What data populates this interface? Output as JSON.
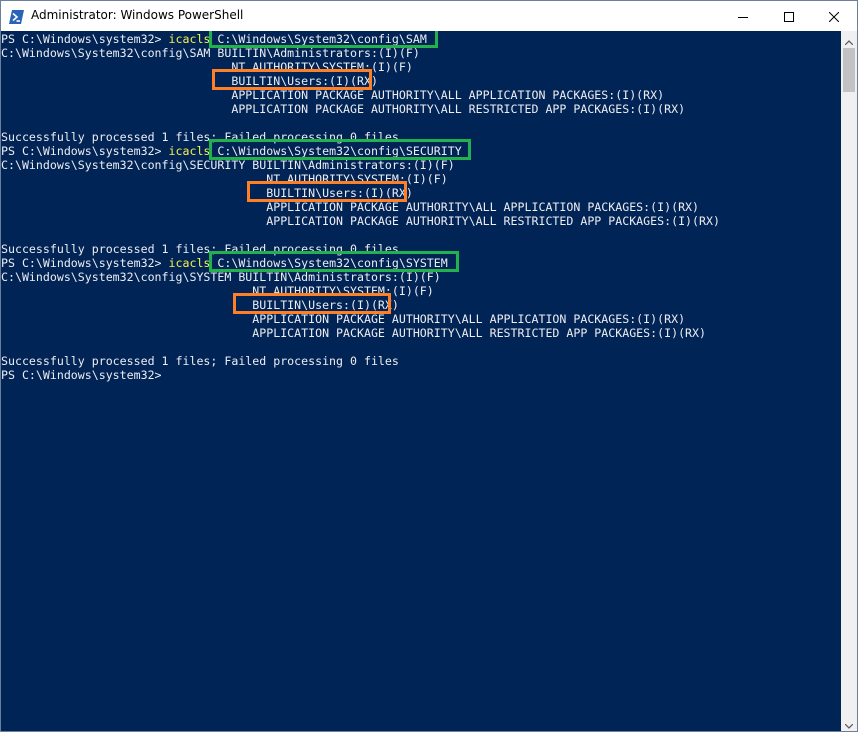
{
  "window": {
    "title": "Administrator: Windows PowerShell",
    "icon": "powershell-icon",
    "controls": {
      "minimize": "minimize-icon",
      "maximize": "maximize-icon",
      "close": "close-icon"
    },
    "colors": {
      "console_background": "#012456",
      "console_text": "#eeedf0",
      "command_keyword": "#f9f14f",
      "highlight_green": "#22b14c",
      "highlight_orange": "#ff7f27"
    }
  },
  "console": {
    "sam": {
      "prompt": "PS C:\\Windows\\system32> ",
      "command": "icacls",
      "path": " C:\\Windows\\System32\\config\\SAM",
      "acl_1": "C:\\Windows\\System32\\config\\SAM BUILTIN\\Administrators:(I)(F)",
      "acl_2": "                                 NT AUTHORITY\\SYSTEM:(I)(F)",
      "acl_3": "                                 BUILTIN\\Users:(I)(RX)",
      "acl_4": "                                 APPLICATION PACKAGE AUTHORITY\\ALL APPLICATION PACKAGES:(I)(RX)",
      "acl_5": "                                 APPLICATION PACKAGE AUTHORITY\\ALL RESTRICTED APP PACKAGES:(I)(RX)",
      "result": "Successfully processed 1 files; Failed processing 0 files"
    },
    "security": {
      "prompt": "PS C:\\Windows\\system32> ",
      "command": "icacls",
      "path": " C:\\Windows\\System32\\config\\SECURITY",
      "acl_1": "C:\\Windows\\System32\\config\\SECURITY BUILTIN\\Administrators:(I)(F)",
      "acl_2": "                                      NT AUTHORITY\\SYSTEM:(I)(F)",
      "acl_3": "                                      BUILTIN\\Users:(I)(RX)",
      "acl_4": "                                      APPLICATION PACKAGE AUTHORITY\\ALL APPLICATION PACKAGES:(I)(RX)",
      "acl_5": "                                      APPLICATION PACKAGE AUTHORITY\\ALL RESTRICTED APP PACKAGES:(I)(RX)",
      "result": "Successfully processed 1 files; Failed processing 0 files"
    },
    "system": {
      "prompt": "PS C:\\Windows\\system32> ",
      "command": "icacls",
      "path": " C:\\Windows\\System32\\config\\SYSTEM",
      "acl_1": "C:\\Windows\\System32\\config\\SYSTEM BUILTIN\\Administrators:(I)(F)",
      "acl_2": "                                    NT AUTHORITY\\SYSTEM:(I)(F)",
      "acl_3": "                                    BUILTIN\\Users:(I)(RX)",
      "acl_4": "                                    APPLICATION PACKAGE AUTHORITY\\ALL APPLICATION PACKAGES:(I)(RX)",
      "acl_5": "                                    APPLICATION PACKAGE AUTHORITY\\ALL RESTRICTED APP PACKAGES:(I)(RX)",
      "result": "Successfully processed 1 files; Failed processing 0 files"
    },
    "final_prompt": "PS C:\\Windows\\system32>"
  }
}
